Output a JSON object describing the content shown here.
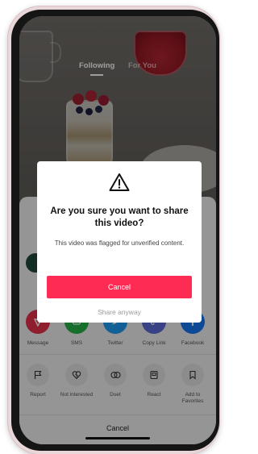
{
  "top_tabs": {
    "following": "Following",
    "for_you": "For You"
  },
  "dialog": {
    "title": "Are you sure you want to share this video?",
    "message": "This video was flagged for unverified content.",
    "cancel_label": "Cancel",
    "share_anyway_label": "Share anyway",
    "icon": "warning-triangle-icon"
  },
  "share_targets": [
    {
      "label": "Message",
      "icon": "message-icon",
      "color": "#e5314b"
    },
    {
      "label": "SMS",
      "icon": "sms-icon",
      "color": "#27b24a"
    },
    {
      "label": "Twitter",
      "icon": "twitter-icon",
      "color": "#1d9bf0"
    },
    {
      "label": "Copy Link",
      "icon": "link-icon",
      "color": "#5b6bd6"
    },
    {
      "label": "Facebook",
      "icon": "facebook-icon",
      "color": "#1877f2"
    }
  ],
  "actions": [
    {
      "label": "Report",
      "icon": "flag-icon"
    },
    {
      "label": "Not interested",
      "icon": "broken-heart-icon"
    },
    {
      "label": "Duet",
      "icon": "duet-icon"
    },
    {
      "label": "React",
      "icon": "react-icon"
    },
    {
      "label": "Add to Favorites",
      "icon": "bookmark-icon"
    }
  ],
  "sheet_cancel_label": "Cancel",
  "colors": {
    "accent": "#fe2c55"
  }
}
